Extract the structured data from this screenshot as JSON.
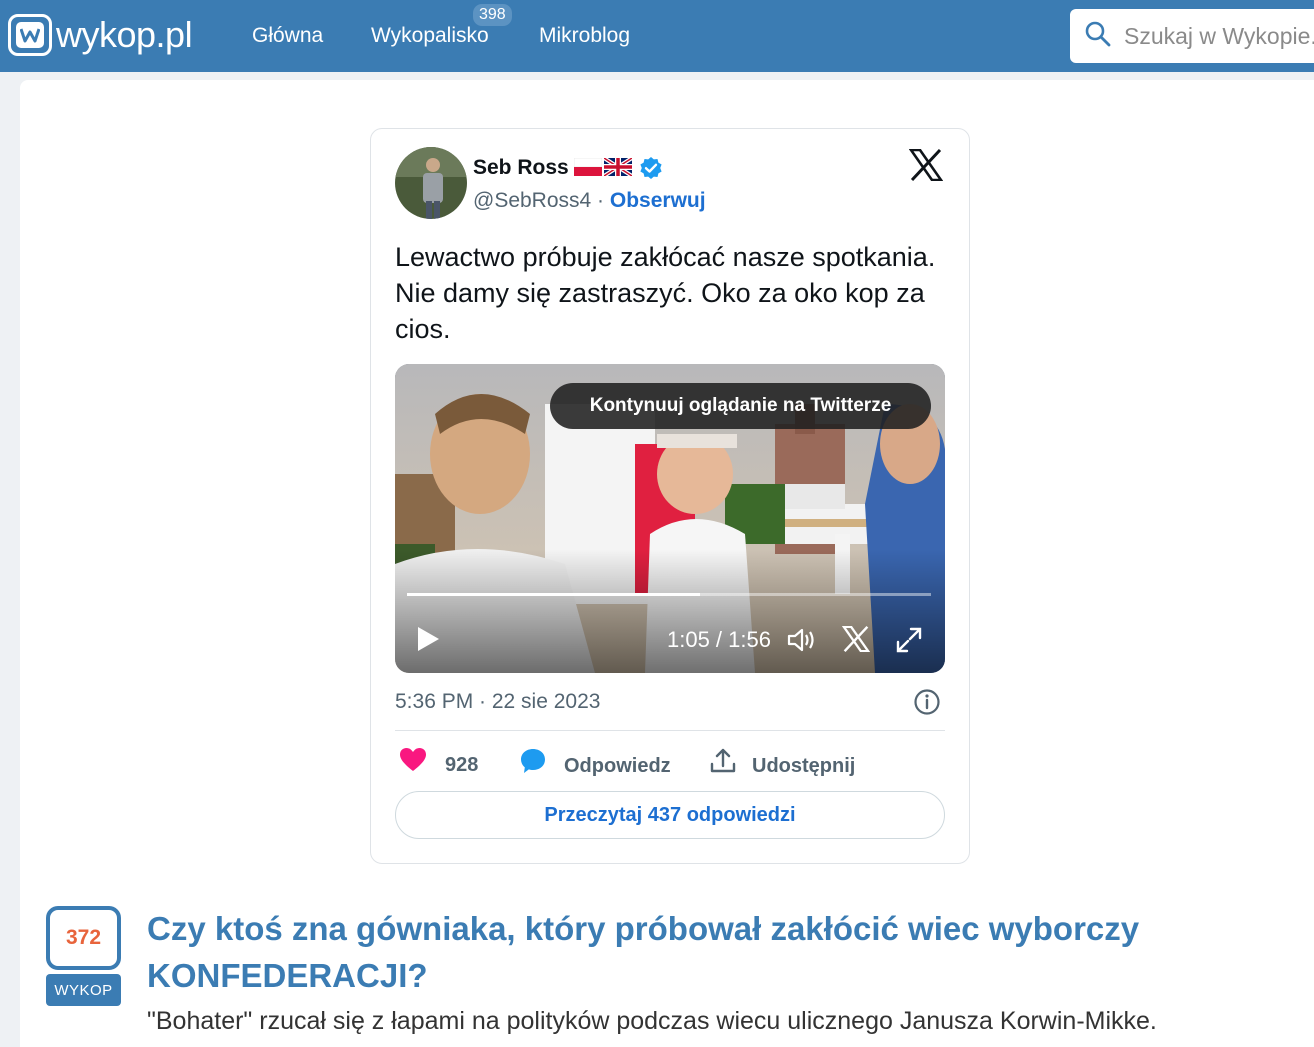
{
  "navbar": {
    "logo_text": "wykop.pl",
    "items": [
      {
        "label": "Główna"
      },
      {
        "label": "Wykopalisko",
        "badge": "398"
      },
      {
        "label": "Mikroblog"
      }
    ],
    "search_placeholder": "Szukaj w Wykopie..."
  },
  "tweet": {
    "author_name": "Seb Ross",
    "handle": "@SebRoss4",
    "separator": " · ",
    "follow_label": "Obserwuj",
    "text": "Lewactwo próbuje zakłócać nasze spotkania. Nie damy się zastraszyć. Oko za oko kop za cios.",
    "video": {
      "overlay_label": "Kontynuuj oglądanie na Twitterze",
      "time": "1:05 / 1:56",
      "progress": 0.56
    },
    "timestamp": "5:36 PM · 22 sie 2023",
    "likes": "928",
    "reply_label": "Odpowiedz",
    "share_label": "Udostępnij",
    "read_replies_label": "Przeczytaj 437 odpowiedzi",
    "colors": {
      "like": "#f91880",
      "link": "#1d6fd1",
      "reply": "#1d9bf0"
    }
  },
  "entry": {
    "votes": "372",
    "vote_button_label": "WYKOP",
    "title": "Czy ktoś zna gówniaka, który próbował zakłócić wiec wyborczy KONFEDERACJI?",
    "description": "\"Bohater\" rzucał się z łapami na polityków podczas wiecu ulicznego Janusza Korwin-Mikke."
  }
}
